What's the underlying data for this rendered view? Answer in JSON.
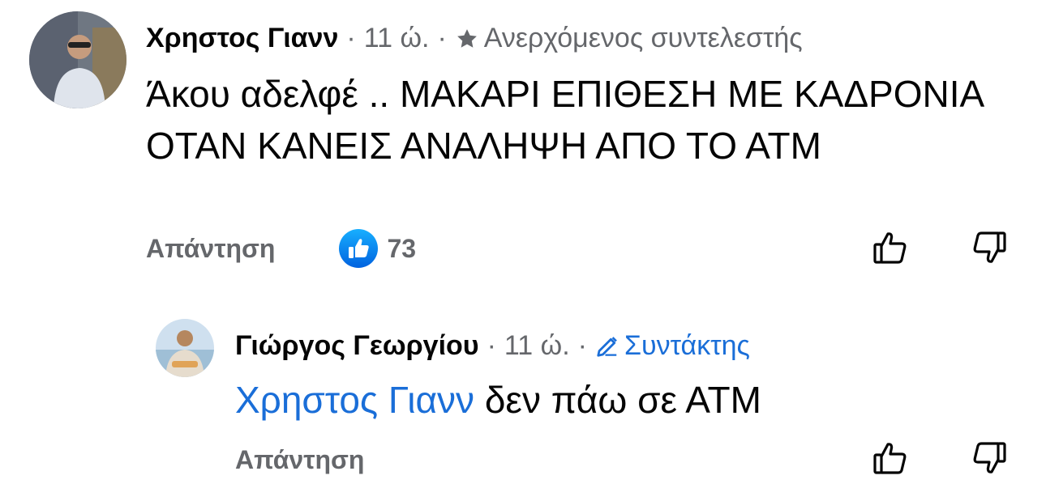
{
  "comment": {
    "author": "Χρηστος Γιανν",
    "time": "11 ώ.",
    "dot1": "·",
    "dot2": "·",
    "badge_label": "Ανερχόμενος συντελεστής",
    "badge_icon": "star-icon",
    "text": "Άκου αδελφέ .. ΜΑΚΑΡΙ ΕΠΙΘΕΣΗ ΜΕ ΚΑΔΡΟΝΙΑ ΟΤΑΝ ΚΑΝΕΙΣ ΑΝΑΛΗΨΗ ΑΠΟ ΤΟ ΑΤΜ",
    "reply_label": "Απάντηση",
    "reaction_icon": "like-icon",
    "reaction_count": "73",
    "upvote_icon": "thumbs-up-outline-icon",
    "downvote_icon": "thumbs-down-outline-icon"
  },
  "reply": {
    "author": "Γιώργος Γεωργίου",
    "time": "11 ώ.",
    "dot1": "·",
    "dot2": "·",
    "badge_label": "Συντάκτης",
    "badge_icon": "pencil-icon",
    "mention": "Χρηστος Γιανν",
    "text": "δεν πάω σε ΑΤΜ",
    "reply_label": "Απάντηση",
    "upvote_icon": "thumbs-up-outline-icon",
    "downvote_icon": "thumbs-down-outline-icon"
  },
  "colors": {
    "link_blue": "#1a6ed8",
    "like_blue": "#1b74e4",
    "secondary_text": "#65676b"
  }
}
